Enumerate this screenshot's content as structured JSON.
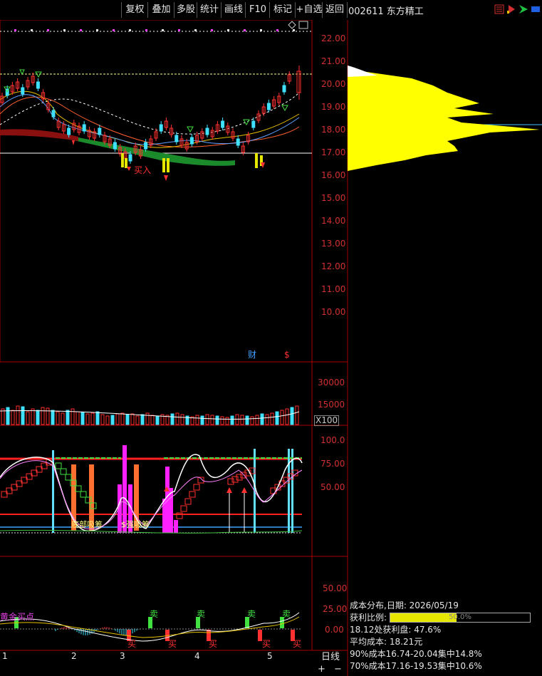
{
  "toolbar": {
    "buttons": [
      "复权",
      "叠加",
      "多股",
      "统计",
      "画线",
      "F10",
      "标记",
      "+自选",
      "返回"
    ]
  },
  "stock": {
    "code": "002611",
    "name": "东方精工"
  },
  "price_axis": [
    "22.00",
    "21.00",
    "20.00",
    "19.00",
    "18.00",
    "17.00",
    "16.00",
    "15.00",
    "14.00",
    "13.00",
    "12.00",
    "11.00",
    "10.00"
  ],
  "volume_axis": [
    "30000",
    "15000"
  ],
  "volume_unit": "X100",
  "indicator_axis": [
    "100.0",
    "75.00",
    "50.00"
  ],
  "macd_axis": [
    "50.00",
    "25.00",
    "0.00"
  ],
  "date_axis": [
    "1",
    "2",
    "3",
    "4",
    "5"
  ],
  "period": "日线",
  "zoom": {
    "plus": "+",
    "minus": "−"
  },
  "markers": {
    "fin": "财",
    "dollar": "$",
    "buy_in": "买入",
    "sell": "卖",
    "buy": "买",
    "chip_1": "底部吸筹",
    "chip_2": "$强吸筹",
    "gold": "黄金买点"
  },
  "cost": {
    "title": "成本分布,日期: 2026/05/19",
    "profit_label": "获利比例:",
    "profit_pct": 47.6,
    "profit_bar_text": "50.0%",
    "profit_at": "18.12处获利盘: 47.6%",
    "avg": "平均成本: 18.21元",
    "c90": "90%成本16.74-20.04集中14.8%",
    "c70": "70%成本17.16-19.53集中10.6%"
  }
}
